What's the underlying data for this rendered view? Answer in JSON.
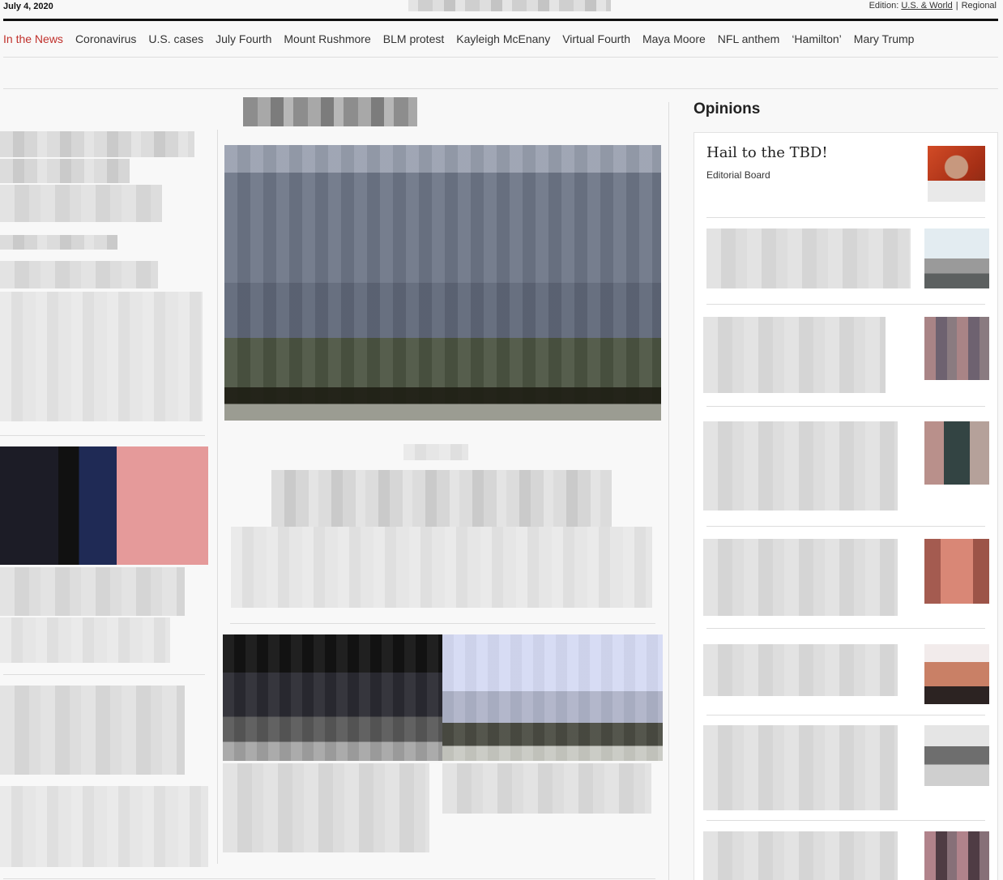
{
  "header": {
    "date": "July 4, 2020",
    "edition_label": "Edition:",
    "edition_current": "U.S. & World",
    "edition_separator": "|",
    "edition_alt": "Regional"
  },
  "nav": {
    "items": [
      "In the News",
      "Coronavirus",
      "U.S. cases",
      "July Fourth",
      "Mount Rushmore",
      "BLM protest",
      "Kayleigh McEnany",
      "Virtual Fourth",
      "Maya Moore",
      "NFL anthem",
      "‘Hamilton’",
      "Mary Trump"
    ]
  },
  "opinions": {
    "section_title": "Opinions",
    "lead": {
      "headline": "Hail to the TBD!",
      "byline": "Editorial Board"
    }
  },
  "colors": {
    "accent": "#c0312c",
    "rule": "#111111"
  }
}
